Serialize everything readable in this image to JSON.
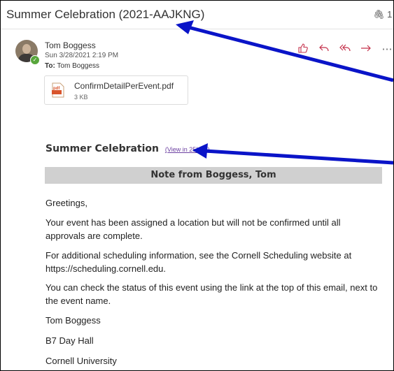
{
  "subject": "Summer Celebration (2021-AAJKNG)",
  "attachment_count": "1 ⌄",
  "header": {
    "sender": "Tom Boggess",
    "date": "Sun 3/28/2021 2:19 PM",
    "to_label": "To:",
    "to_value": "Tom Boggess",
    "actions": [
      "like-icon",
      "reply-icon",
      "reply-all-icon",
      "forward-icon",
      "more-icon"
    ],
    "action_color": "#c4314b"
  },
  "attachment": {
    "name": "ConfirmDetailPerEvent.pdf",
    "size": "3 KB",
    "icon_label": "pdf"
  },
  "body": {
    "title": "Summer Celebration",
    "view_link": "(View in 25Live)",
    "note_header": "Note from Boggess, Tom",
    "paragraphs": [
      "Greetings,",
      "Your event has been assigned a location but will not be confirmed until all approvals are complete.",
      "For additional scheduling information, see the Cornell Scheduling website at https://scheduling.cornell.edu.",
      "You can check the status of this event using the link at the top of this email, next to the event name.",
      "Tom Boggess",
      "B7 Day Hall",
      "Cornell University"
    ]
  },
  "annotation_color": "#0a14c8"
}
